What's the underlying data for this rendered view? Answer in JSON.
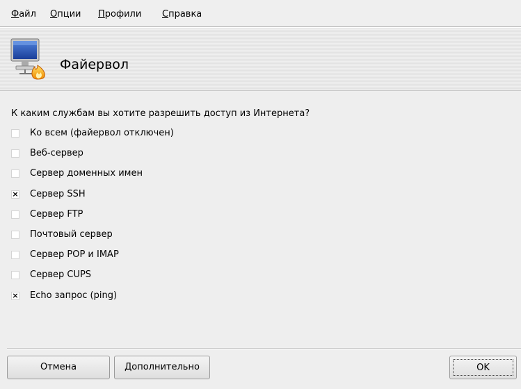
{
  "menu": {
    "file": {
      "mnemonic": "Ф",
      "rest": "айл"
    },
    "options": {
      "mnemonic": "О",
      "rest": "пции"
    },
    "profiles": {
      "mnemonic": "П",
      "rest": "рофили"
    },
    "help": {
      "mnemonic": "С",
      "rest": "правка"
    }
  },
  "header": {
    "title": "Файервол",
    "icon": "monitor-fire-icon"
  },
  "question": "К каким службам вы хотите разрешить доступ из Интернета?",
  "services": [
    {
      "label": "Ко всем (файервол отключен)",
      "checked": false
    },
    {
      "label": "Веб-сервер",
      "checked": false
    },
    {
      "label": "Сервер доменных имен",
      "checked": false
    },
    {
      "label": "Сервер SSH",
      "checked": true
    },
    {
      "label": "Сервер FTP",
      "checked": false
    },
    {
      "label": "Почтовый сервер",
      "checked": false
    },
    {
      "label": "Сервер POP и IMAP",
      "checked": false
    },
    {
      "label": "Сервер CUPS",
      "checked": false
    },
    {
      "label": "Echo запрос (ping)",
      "checked": true
    }
  ],
  "buttons": {
    "cancel": "Отмена",
    "advanced": "Дополнительно",
    "ok": "OK"
  }
}
